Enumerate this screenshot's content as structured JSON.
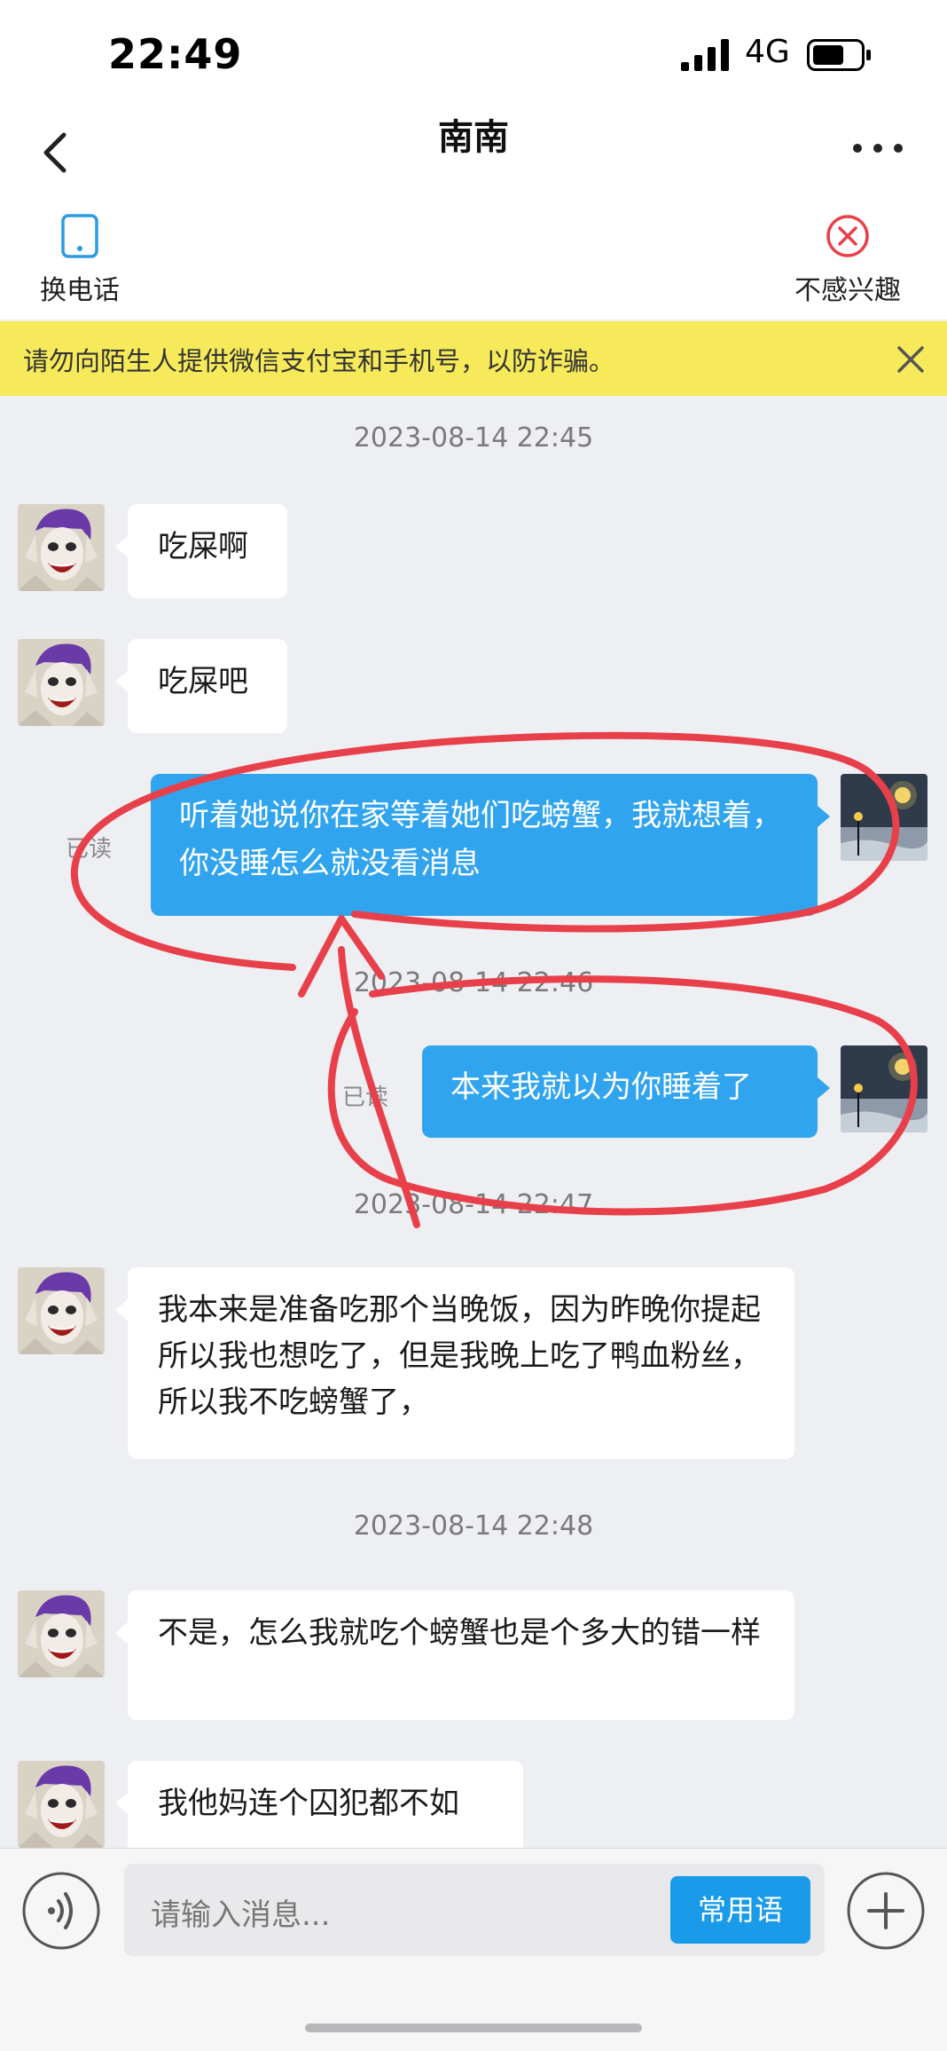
{
  "status_bar": {
    "time": "22:49",
    "network": "4G"
  },
  "header": {
    "title": "南南"
  },
  "actions": {
    "switch_phone": "换电话",
    "not_interested": "不感兴趣"
  },
  "notice": {
    "text": "请勿向陌生人提供微信支付宝和手机号，以防诈骗。"
  },
  "messages": {
    "ts1": "2023-08-14 22:45",
    "m1": "吃屎啊",
    "m2": "吃屎吧",
    "m3": "听着她说你在家等着她们吃螃蟹，我就想着，你没睡怎么就没看消息",
    "read1": "已读",
    "ts2": "2023-08-14 22:46",
    "m4": "本来我就以为你睡着了",
    "read2": "已读",
    "ts3": "2023-08-14 22:47",
    "m5": "我本来是准备吃那个当晚饭，因为昨晚你提起所以我也想吃了，但是我晚上吃了鸭血粉丝，所以我不吃螃蟹了，",
    "ts4": "2023-08-14 22:48",
    "m6": "不是，怎么我就吃个螃蟹也是个多大的错一样",
    "m7": "我他妈连个囚犯都不如"
  },
  "input": {
    "placeholder": "请输入消息...",
    "phrases_label": "常用语"
  },
  "colors": {
    "accent": "#31a4ef",
    "notice_bg": "#f6ea5b",
    "annotation": "#e8404a"
  }
}
